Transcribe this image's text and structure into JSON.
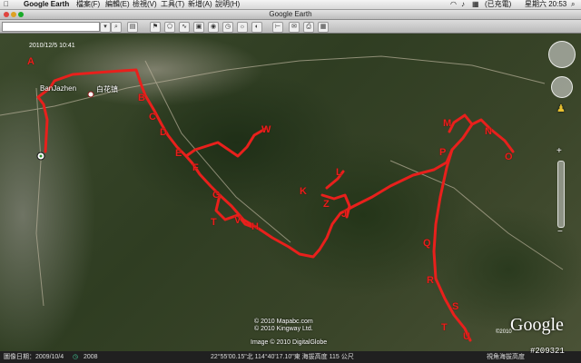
{
  "menubar": {
    "apple": "",
    "app_name": "Google Earth",
    "items": [
      "檔案(F)",
      "編輯(E)",
      "檢視(V)",
      "工具(T)",
      "新增(A)",
      "說明(H)"
    ],
    "status_text": "(已充電)",
    "time": "星期六 20:53"
  },
  "window": {
    "title": "Google Earth"
  },
  "toolbar": {
    "search_placeholder": "",
    "buttons": [
      "play-icon",
      "search-icon",
      "hand-icon",
      "path-icon",
      "polygon-icon",
      "overlay-icon",
      "tour-icon",
      "history-icon",
      "earth-icon",
      "sun-icon",
      "mail-icon",
      "print-icon",
      "email-icon",
      "map-icon"
    ]
  },
  "map": {
    "timestamp": "2010/12/5  10:41",
    "place_name_en": "BanJazhen",
    "place_name_zh": "白花镇",
    "markers": [
      "A",
      "B",
      "C",
      "D",
      "E",
      "F",
      "G",
      "T",
      "V",
      "H",
      "W",
      "L",
      "K",
      "Z",
      "J",
      "M",
      "N",
      "O",
      "P",
      "Q",
      "R",
      "S",
      "T",
      "U"
    ],
    "copyright_lines": [
      "© 2010 Mapabc.com",
      "© 2010 Kingway Ltd.",
      "Image © 2010 DigitalGlobe"
    ],
    "google_logo": "Google",
    "google_year": "©2010",
    "route_color": "#e8201c"
  },
  "statusbar": {
    "imagery_date": "圖像日期：2009/10/4",
    "year": "2008",
    "coords": "22°55'00.15\"北 114°40'17.10\"東 海拔高度  115 公尺",
    "eye_alt": "視角海拔高度"
  },
  "watermark": "#209321"
}
